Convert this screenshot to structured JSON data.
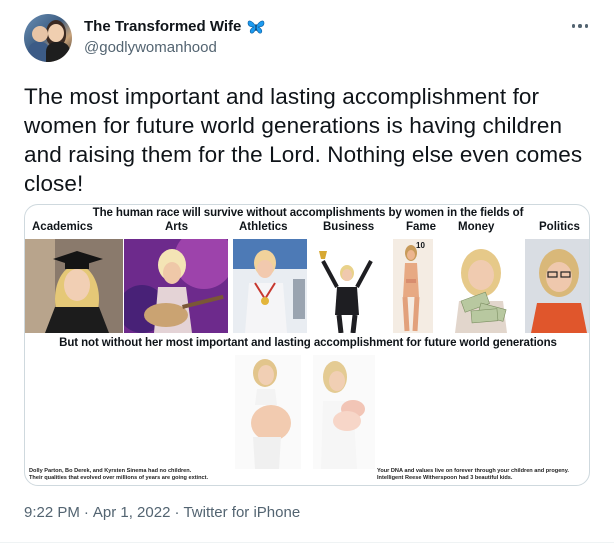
{
  "header": {
    "display_name": "The Transformed Wife",
    "handle": "@godlywomanhood",
    "badge_icon": "butterfly-icon",
    "more_icon": "more-options-icon"
  },
  "tweet": {
    "text": "The most important and lasting accomplishment for women for future world generations is having children and raising them for the Lord. Nothing else even comes close!"
  },
  "media": {
    "title": "The human race will survive without  accomplishments by women  in the fields of",
    "categories": [
      "Academics",
      "Arts",
      "Athletics",
      "Business",
      "Fame",
      "Money",
      "Politics"
    ],
    "fame_badge": "10",
    "middle_text": "But not without her  most  important and lasting accomplishment for future world generations",
    "footnote_left_1": "Dolly Parton, Bo Derek, and Kyrsten Sinema had no children.",
    "footnote_left_2": "Their qualities that evolved over millions of years are going extinct.",
    "footnote_right_1": "Your DNA and values live on forever through your children and progeny.",
    "footnote_right_2": "Intelligent Reese Witherspoon had 3 beautiful kids."
  },
  "meta": {
    "time": "9:22 PM",
    "separator": "·",
    "date": "Apr 1, 2022",
    "source": "Twitter for iPhone"
  },
  "colors": {
    "text": "#0f1419",
    "secondary": "#536471",
    "border": "#cfd9de",
    "butterfly": "#1d9bf0"
  }
}
